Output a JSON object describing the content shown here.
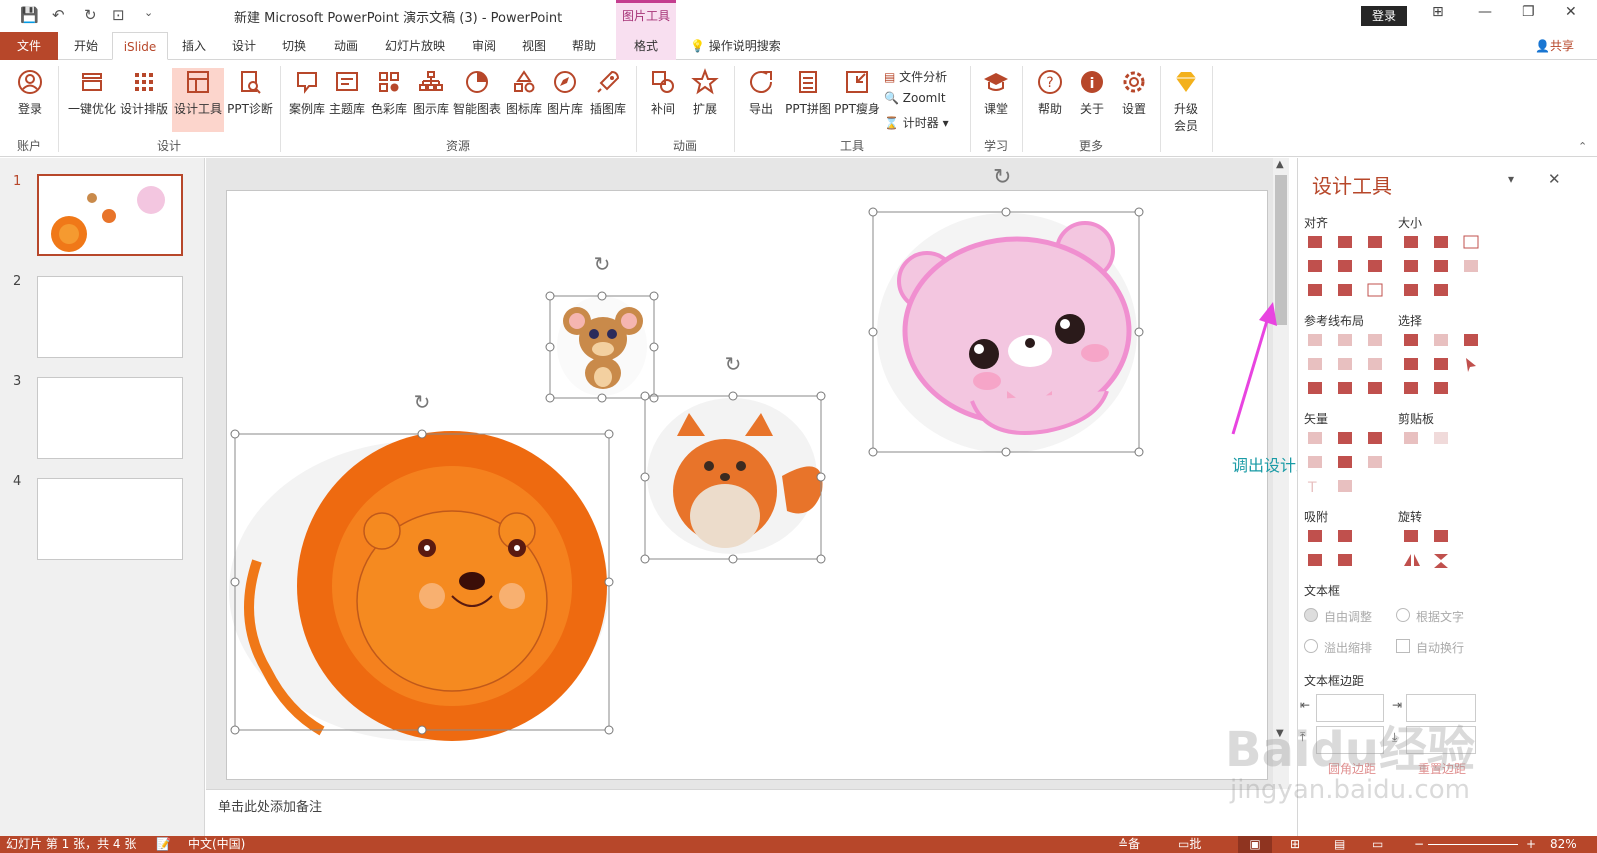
{
  "titlebar": {
    "doc_title": "新建 Microsoft PowerPoint 演示文稿 (3)  -  PowerPoint",
    "context_tool": "图片工具",
    "login": "登录"
  },
  "tabs": [
    "文件",
    "开始",
    "iSlide",
    "插入",
    "设计",
    "切换",
    "动画",
    "幻灯片放映",
    "审阅",
    "视图",
    "帮助",
    "格式"
  ],
  "tell_me": "操作说明搜索",
  "share": "共享",
  "ribbon": {
    "buttons": [
      "登录",
      "一键优化",
      "设计排版",
      "设计工具",
      "PPT诊断",
      "案例库",
      "主题库",
      "色彩库",
      "图示库",
      "智能图表",
      "图标库",
      "图片库",
      "插图库",
      "补间",
      "扩展",
      "导出",
      "PPT拼图",
      "PPT瘦身",
      "课堂",
      "帮助",
      "关于",
      "设置",
      "升级",
      "会员"
    ],
    "small": [
      "文件分析",
      "ZoomIt",
      "计时器"
    ],
    "groups": [
      "账户",
      "设计",
      "资源",
      "动画",
      "工具",
      "学习",
      "更多"
    ]
  },
  "thumbs": [
    "1",
    "2",
    "3",
    "4"
  ],
  "notes": "单击此处添加备注",
  "panel": {
    "title": "设计工具",
    "sections": [
      "对齐",
      "大小",
      "参考线布局",
      "选择",
      "矢量",
      "剪贴板",
      "吸附",
      "旋转",
      "文本框",
      "文本框边距"
    ],
    "options": [
      "自由调整",
      "根据文字",
      "溢出缩排",
      "自动换行"
    ],
    "bottom": [
      "圆角边距",
      "重置边距"
    ]
  },
  "statusbar": {
    "slide_info": "幻灯片 第 1 张，共 4 张",
    "lang": "中文(中国)",
    "notes": "备注",
    "comments": "批注",
    "zoom": "82%"
  },
  "annotation": "调出设计工具",
  "watermark": "Baidu经验",
  "watermark_url": "jingyan.baidu.com"
}
